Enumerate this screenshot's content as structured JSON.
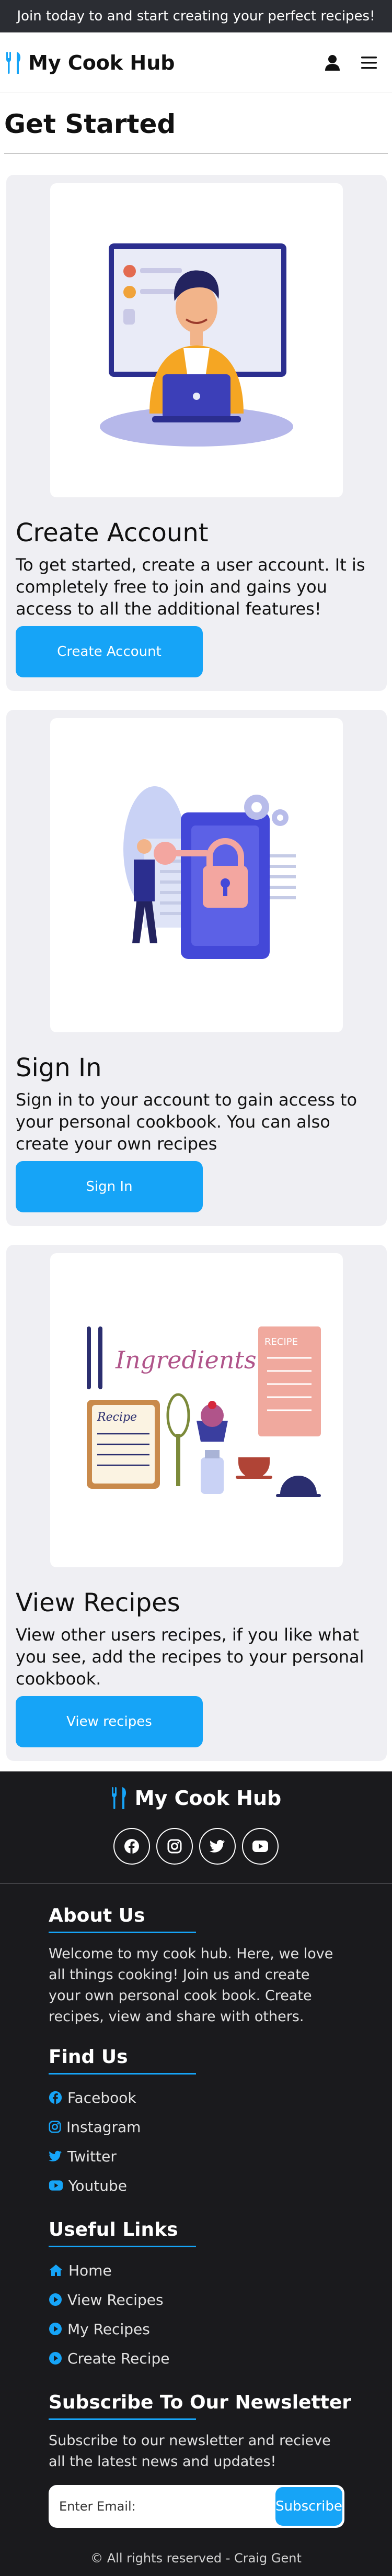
{
  "banner": {
    "text": "Join today to and start creating your perfect recipes!"
  },
  "nav": {
    "brand": "My Cook Hub",
    "icons": [
      "utensils-icon",
      "user-icon",
      "menu-icon"
    ]
  },
  "page": {
    "title": "Get Started"
  },
  "cards": [
    {
      "title": "Create Account",
      "text": "To get started, create a user account. It is completely free to join and gains you access to all the additional features!",
      "button": "Create Account"
    },
    {
      "title": "Sign In",
      "text": "Sign in to your account to gain access to your personal cookbook. You can also create your own recipes",
      "button": "Sign In"
    },
    {
      "title": "View Recipes",
      "text": "View other users recipes, if you like what you see, add the recipes to your personal cookbook.",
      "button": "View recipes"
    }
  ],
  "illustrations": {
    "recipes_word": "Ingredients",
    "recipe_card": "Recipe",
    "recipe_note": "RECIPE"
  },
  "footer": {
    "brand": "My Cook Hub",
    "about": {
      "heading": "About Us",
      "text": "Welcome to my cook hub. Here, we love all things cooking! Join us and create your own personal cook book. Create recipes, view and share with others."
    },
    "find": {
      "heading": "Find Us",
      "items": [
        "Facebook",
        "Instagram",
        "Twitter",
        "Youtube"
      ]
    },
    "links": {
      "heading": "Useful Links",
      "items": [
        "Home",
        "View Recipes",
        "My Recipes",
        "Create Recipe"
      ]
    },
    "newsletter": {
      "heading": "Subscribe To Our Newsletter",
      "text": "Subscribe to our newsletter and recieve all the latest news and updates!",
      "placeholder": "Enter Email:",
      "button": "Subscribe"
    },
    "copyright": "© All rights reserved - Craig Gent"
  },
  "colors": {
    "accent": "#16a4f7",
    "banner": "#2b2d33",
    "footer": "#1a1a1d",
    "card": "#efeff3"
  }
}
